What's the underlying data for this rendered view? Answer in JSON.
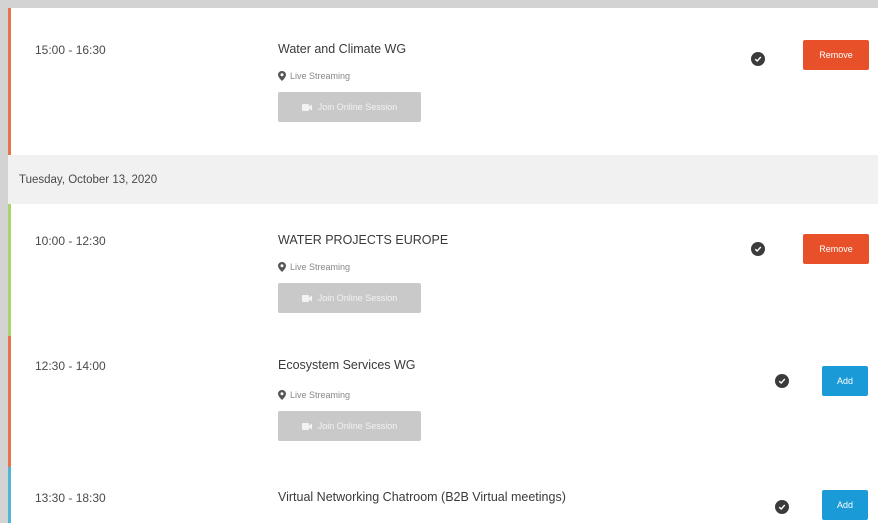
{
  "sessions_before": [
    {
      "time": "15:00 - 16:30",
      "title": "Water and Climate WG",
      "location": "Live Streaming",
      "join_label": "Join Online Session",
      "action_label": "Remove",
      "bar_color": "#e6744a"
    }
  ],
  "day_header": "Tuesday, October 13, 2020",
  "sessions": [
    {
      "time": "10:00 - 12:30",
      "title": "WATER PROJECTS EUROPE",
      "location": "Live Streaming",
      "join_label": "Join Online Session",
      "action_label": "Remove",
      "bar_color": "#a7d46b"
    },
    {
      "time": "12:30 - 14:00",
      "title": "Ecosystem Services WG",
      "location": "Live Streaming",
      "join_label": "Join Online Session",
      "action_label": "Add",
      "bar_color": "#e6744a"
    },
    {
      "time": "13:30 - 18:30",
      "title": "Virtual Networking Chatroom (B2B Virtual meetings)",
      "action_label": "Add",
      "bar_color": "#4fb6d8"
    }
  ],
  "colors": {
    "remove": "#e8502a",
    "add": "#1a9ad6",
    "join_disabled": "#c9c9c9",
    "check": "#3b3b3b"
  },
  "icons": {
    "location": "map-pin-icon",
    "camera": "video-camera-icon",
    "status": "check-circle-icon"
  }
}
